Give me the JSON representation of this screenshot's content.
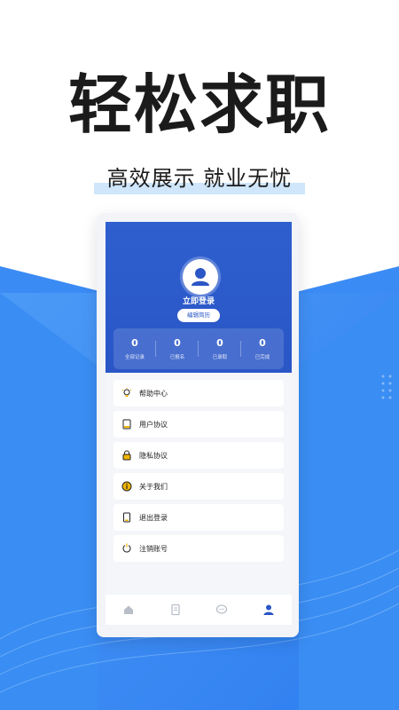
{
  "promo": {
    "headline": "轻松求职",
    "subline": "高效展示 就业无忧"
  },
  "colors": {
    "brand_blue": "#2a56c6",
    "background_blue": "#3b8bf5",
    "accent_light": "#cfe6fb"
  },
  "profile": {
    "avatar_icon": "user-icon",
    "login_label": "立即登录",
    "edit_resume_label": "编辑简历",
    "stats": [
      {
        "value": "0",
        "label": "全部记录"
      },
      {
        "value": "0",
        "label": "已报名"
      },
      {
        "value": "0",
        "label": "已录取"
      },
      {
        "value": "0",
        "label": "已完成"
      }
    ]
  },
  "menu": {
    "items": [
      {
        "label": "帮助中心",
        "icon": "lightbulb-icon"
      },
      {
        "label": "用户协议",
        "icon": "document-icon"
      },
      {
        "label": "隐私协议",
        "icon": "lock-icon"
      },
      {
        "label": "关于我们",
        "icon": "info-icon"
      },
      {
        "label": "退出登录",
        "icon": "logout-icon"
      },
      {
        "label": "注销账号",
        "icon": "power-icon"
      }
    ]
  },
  "tabbar": {
    "tabs": [
      {
        "icon": "home-icon",
        "active": false
      },
      {
        "icon": "book-icon",
        "active": false
      },
      {
        "icon": "chat-icon",
        "active": false
      },
      {
        "icon": "user-icon",
        "active": true
      }
    ]
  }
}
